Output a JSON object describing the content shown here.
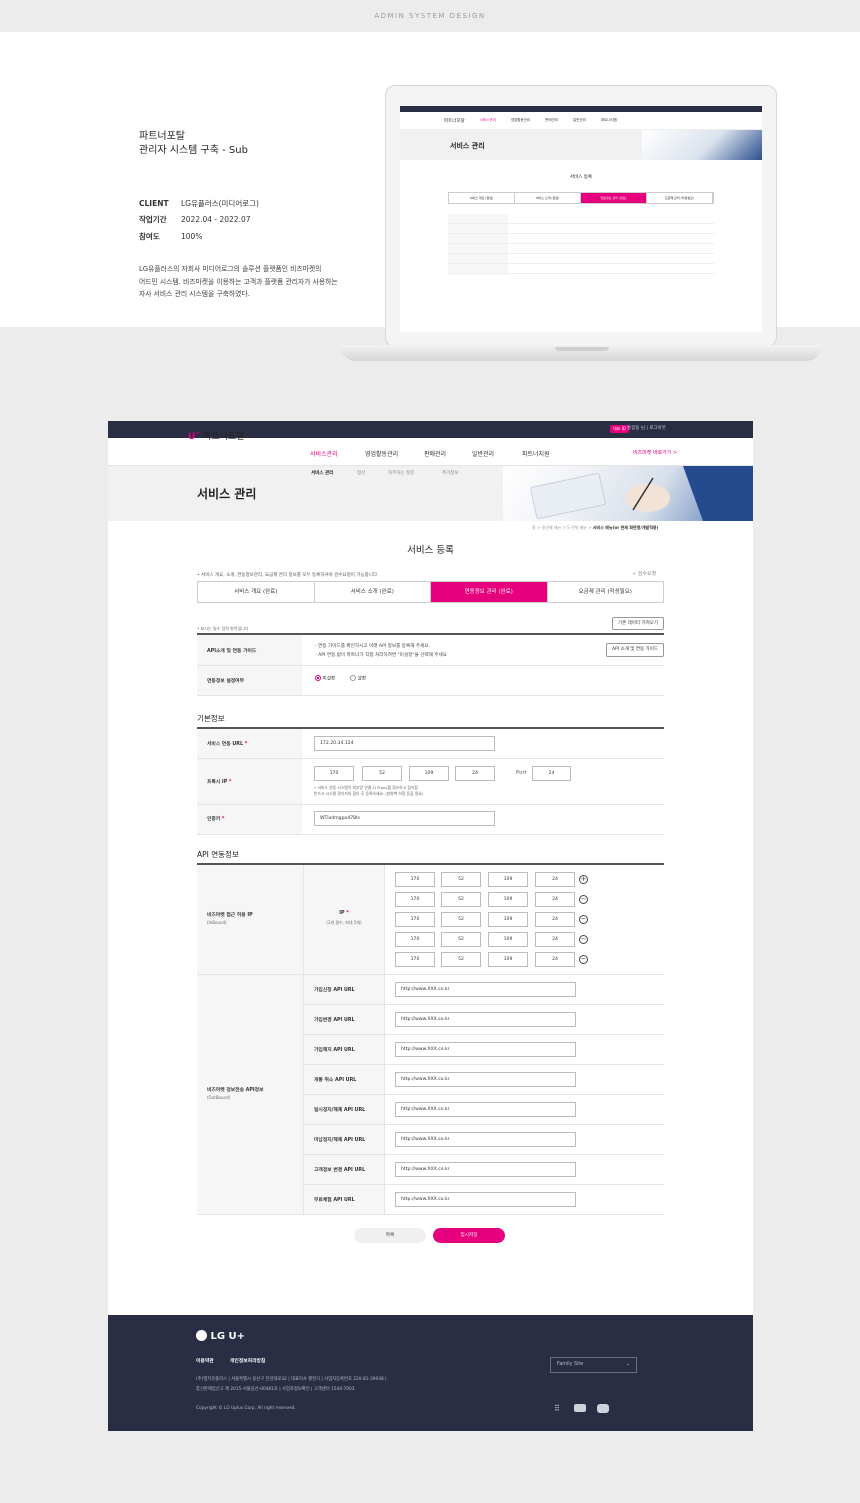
{
  "caption": "ADMIN SYSTEM DESIGN",
  "intro": {
    "title_line1": "파트너포탈",
    "title_line2": "관리자 시스템 구축 - Sub",
    "client_label": "CLIENT",
    "client_value": "LG유플러스(미디어로그)",
    "period_label": "작업기간",
    "period_value": "2022.04 - 2022.07",
    "participation_label": "참여도",
    "participation_value": "100%",
    "desc_line1": "LG유플러스의 자회사 미디어로그의 솔루션 플랫폼인 비즈마켓의",
    "desc_line2": "어드민 시스템. 비즈마켓을 이용하는 고객과 플랫폼 관리자가 사용하는",
    "desc_line3": "자사 서비스 관리 시스템을 구축하였다."
  },
  "header": {
    "badge": "대표 ID",
    "user": "홍길동 님   |   로그아웃",
    "logo_mark": "U",
    "logo_text": "파트너포탈",
    "menu": [
      "서비스관리",
      "영업활동관리",
      "판매관리",
      "일반관리",
      "파트너지원"
    ],
    "to_mall": "비즈마켓 바로가기 >",
    "submenu": [
      "서비스 관리",
      "정산",
      "자주하는 질문",
      "추가정보"
    ]
  },
  "banner": {
    "title": "서비스 관리"
  },
  "breadcrumb": {
    "path": "홈  >  정산매 메뉴  >  S 전체 메뉴  >  ",
    "current": "서비스 메뉴(or 현재 화면명/개발적용)"
  },
  "form": {
    "title": "서비스 등록",
    "note": "• 서비스 개요, 소개, 연동정보관리, 요금제 관리 정보를 모두 등록하셔야 검수요청이 가능합니다.",
    "help": "검수요청",
    "tabs": [
      "서비스 개요 (완료)",
      "서비스 소개 (완료)",
      "연동정보 관리 (완료)",
      "요금제 관리 (작성필요)"
    ],
    "required_note": "• 표시는 필수 입력 항목입니다",
    "load_button": "기존 데이터 가져오기",
    "api_guide_label": "API소개 및 연동 가이드",
    "api_guide_line1": "- 연동 가이드를 확인하시고 아래 API 정보를 등록해 주세요.",
    "api_guide_line2": "- API 연동 없이 파트너가 직접 처리하려면 \"미설정\"을 선택해 주세요",
    "api_guide_button": "API 소개 및 연동 가이드",
    "setting_label": "연동정보 설정여부",
    "radio_off": "미설정",
    "radio_on": "설정",
    "basic_title": "기본정보",
    "service_url_label": "서비스 연동 URL",
    "service_url_value": "172.20.34.124",
    "proxy_label": "프록시 IP",
    "proxy_ip": [
      "170",
      "52",
      "109",
      "24"
    ],
    "port_label": "Port",
    "port_value": "24",
    "proxy_note1": "•  서비스 연동 시스템이 외부망 연결 시 Proxy를 경유하고 접속합",
    "proxy_note2": "   반드시 시스템 관리자와 협의 후 등록하세요. (방화벽 허용 등을 필요)",
    "cert_label": "인증키",
    "cert_value": "WTiodmgpo478Is",
    "api_title": "API 연동정보",
    "inbound_label": "비즈마켓 접근 허용 IP",
    "inbound_sub": "(InBound)",
    "ip_label": "IP",
    "ip_sub": "(1개 필수, 최대 5개)",
    "ip_rows": [
      [
        "170",
        "52",
        "109",
        "24"
      ],
      [
        "170",
        "52",
        "109",
        "24"
      ],
      [
        "170",
        "52",
        "109",
        "24"
      ],
      [
        "170",
        "52",
        "109",
        "24"
      ],
      [
        "170",
        "52",
        "109",
        "24"
      ]
    ],
    "outbound_label": "비즈마켓 정보전송 API정보",
    "outbound_sub": "(OutBound)",
    "api_rows": [
      {
        "label": "가입신청 API URL",
        "value": "http://www.XXX.co.kr"
      },
      {
        "label": "가입변경 API URL",
        "value": "http://www.XXX.co.kr"
      },
      {
        "label": "가입해지 API URL",
        "value": "http://www.XXX.co.kr"
      },
      {
        "label": "개통 취소 API URL",
        "value": "http://www.XXX.co.kr"
      },
      {
        "label": "일시정지/해제 API URL",
        "value": "http://www.XXX.co.kr"
      },
      {
        "label": "미납정지/해제 API URL",
        "value": "http://www.XXX.co.kr"
      },
      {
        "label": "고객정보 변경 API URL",
        "value": "http://www.XXX.co.kr"
      },
      {
        "label": "무료체험 API URL",
        "value": "http://www.XXX.co.kr"
      }
    ],
    "list_button": "목록",
    "save_button": "임시저장"
  },
  "footer": {
    "logo": "LG U+",
    "link1": "이용약관",
    "link2": "개인정보처리방침",
    "addr1": "(주)엘지유플러스  |  서울특별시 용산구 한강대로32  |  대표이사 황현식  |  사업자등록번호 220-81-39938  |",
    "addr2": "통신판매업신고 제 2015-서울용산-00481호  |  사업자정보확인  |  고객센터 1544-7003",
    "copyright": "Copyright © LG Uplus Corp. All right reserved.",
    "family_site": "Family Site"
  },
  "colors": {
    "accent": "#e6007e",
    "dark": "#2a2e45",
    "bg": "#ececec"
  },
  "icons": [
    "send-icon",
    "plus-circle-icon",
    "minus-circle-icon",
    "chevron-down-icon",
    "tstore-icon",
    "blog-icon",
    "youtube-icon"
  ]
}
